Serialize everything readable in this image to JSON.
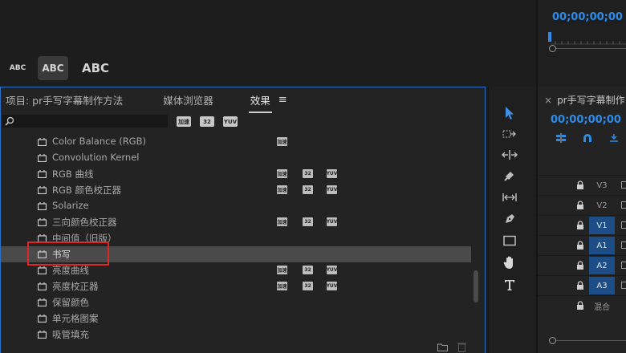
{
  "top": {
    "styles": [
      "ABC",
      "ABC",
      "ABC"
    ],
    "timecode": "00;00;00;00"
  },
  "panel": {
    "tabs": {
      "project": "项目: pr手写字幕制作方法",
      "media_browser": "媒体浏览器",
      "effects": "效果"
    },
    "search_value": "",
    "filters": [
      "加速",
      "32",
      "YUV"
    ]
  },
  "effects": [
    {
      "label": "Color Balance (RGB)",
      "badges": [
        "加速"
      ]
    },
    {
      "label": "Convolution Kernel",
      "badges": []
    },
    {
      "label": "RGB 曲线",
      "badges": [
        "加速",
        "32",
        "YUV"
      ]
    },
    {
      "label": "RGB 颜色校正器",
      "badges": [
        "加速",
        "32",
        "YUV"
      ]
    },
    {
      "label": "Solarize",
      "badges": []
    },
    {
      "label": "三向颜色校正器",
      "badges": [
        "加速",
        "32",
        "YUV"
      ]
    },
    {
      "label": "中间值（旧版）",
      "badges": []
    },
    {
      "label": "书写",
      "badges": [],
      "selected": true
    },
    {
      "label": "亮度曲线",
      "badges": [
        "加速",
        "32",
        "YUV"
      ]
    },
    {
      "label": "亮度校正器",
      "badges": [
        "加速",
        "32",
        "YUV"
      ]
    },
    {
      "label": "保留颜色",
      "badges": []
    },
    {
      "label": "单元格图案",
      "badges": []
    },
    {
      "label": "吸管填充",
      "badges": []
    }
  ],
  "tools": [
    "selection-tool",
    "track-select-tool",
    "ripple-edit-tool",
    "razor-tool",
    "slip-tool",
    "pen-tool",
    "rectangle-tool",
    "hand-tool",
    "type-tool"
  ],
  "timeline": {
    "sequence_name": "pr手写字幕制作",
    "close_glyph": "×",
    "timecode": "00;00;00;00",
    "tracks": [
      {
        "label": "V3",
        "active": false
      },
      {
        "label": "V2",
        "active": false
      },
      {
        "label": "V1",
        "active": true
      },
      {
        "label": "A1",
        "active": true
      },
      {
        "label": "A2",
        "active": true
      },
      {
        "label": "A3",
        "active": true
      },
      {
        "label": "混合",
        "active": false
      }
    ]
  },
  "colors": {
    "accent": "#2d8ceb",
    "panel_border": "#2d6fc8",
    "highlight": "#e02626",
    "track_active": "#1c4d86"
  }
}
